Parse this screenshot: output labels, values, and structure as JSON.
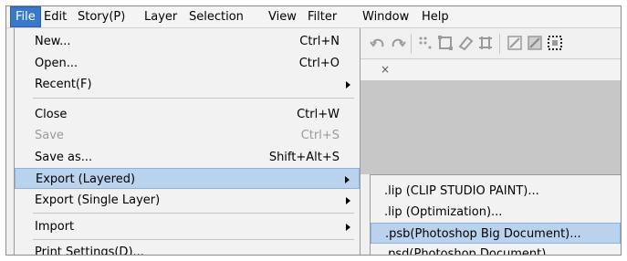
{
  "menubar": {
    "items": [
      {
        "label": "File"
      },
      {
        "label": "Edit"
      },
      {
        "label": "Story(P)"
      },
      {
        "label": "Layer"
      },
      {
        "label": "Selection"
      },
      {
        "label": "View"
      },
      {
        "label": "Filter"
      },
      {
        "label": "Window"
      },
      {
        "label": "Help"
      }
    ]
  },
  "file_menu": {
    "items": [
      {
        "label": "New...",
        "shortcut": "Ctrl+N"
      },
      {
        "label": "Open...",
        "shortcut": "Ctrl+O"
      },
      {
        "label": "Recent(F)",
        "submenu": true
      },
      {
        "label": "Close",
        "shortcut": "Ctrl+W"
      },
      {
        "label": "Save",
        "shortcut": "Ctrl+S",
        "disabled": true
      },
      {
        "label": "Save as...",
        "shortcut": "Shift+Alt+S"
      },
      {
        "label": "Export (Layered)",
        "submenu": true,
        "highlighted": true
      },
      {
        "label": "Export (Single Layer)",
        "submenu": true
      },
      {
        "label": "Import",
        "submenu": true
      },
      {
        "label": "Print Settings(D)..."
      }
    ]
  },
  "export_layered_submenu": {
    "items": [
      {
        "label": ".lip (CLIP STUDIO PAINT)..."
      },
      {
        "label": ".lip (Optimization)..."
      },
      {
        "label": ".psb(Photoshop Big Document)...",
        "highlighted": true
      },
      {
        "label": ".psd(Photoshop Document)..."
      }
    ]
  },
  "background": {
    "tab_close": "×"
  },
  "colors": {
    "menubar_active": "#3a78c9",
    "highlight": "#b9d3ef",
    "canvas_gray": "#c7c7c7"
  }
}
